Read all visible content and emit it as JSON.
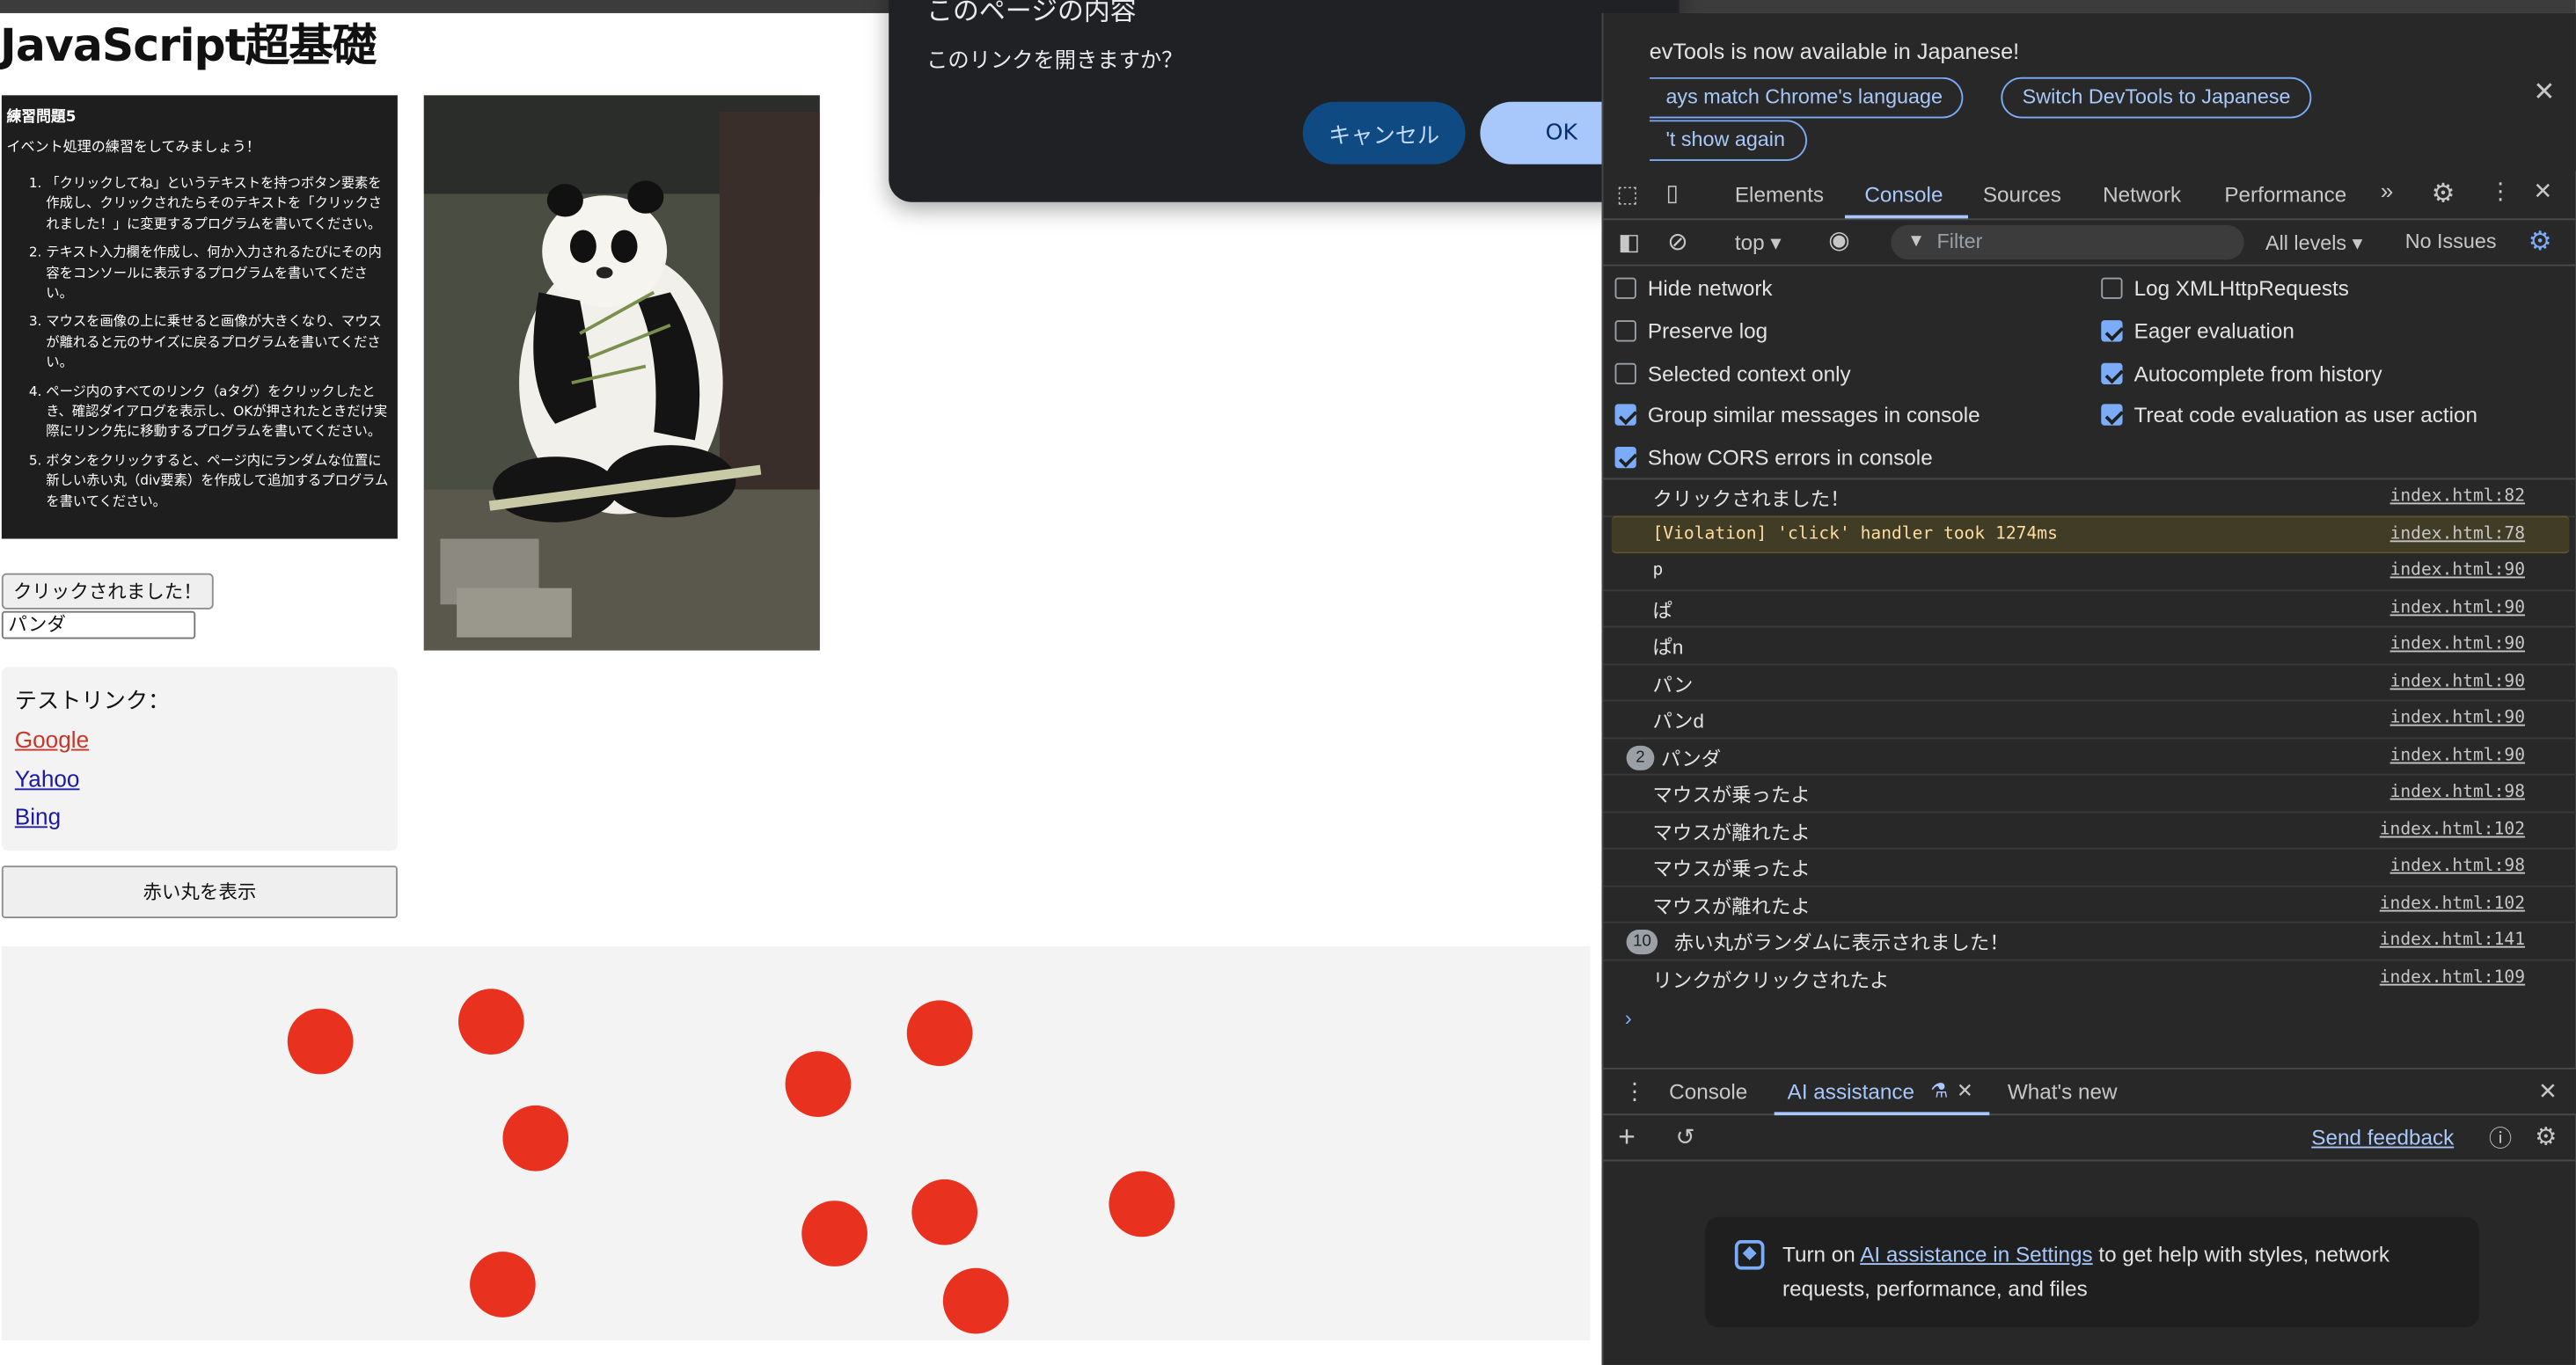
{
  "page": {
    "title": "JavaScript超基礎",
    "exercise": {
      "heading": "練習問題5",
      "intro": "イベント処理の練習をしてみましょう！",
      "items": [
        "「クリックしてね」というテキストを持つボタン要素を作成し、クリックされたらそのテキストを「クリックされました！」に変更するプログラムを書いてください。",
        "テキスト入力欄を作成し、何か入力されるたびにその内容をコンソールに表示するプログラムを書いてください。",
        "マウスを画像の上に乗せると画像が大きくなり、マウスが離れると元のサイズに戻るプログラムを書いてください。",
        "ページ内のすべてのリンク（aタグ）をクリックしたとき、確認ダイアログを表示し、OKが押されたときだけ実際にリンク先に移動するプログラムを書いてください。",
        "ボタンをクリックすると、ページ内にランダムな位置に新しい赤い丸（div要素）を作成して追加するプログラムを書いてください。"
      ]
    },
    "clicked_button_label": "クリックされました！",
    "text_input_value": "パンダ",
    "links_title": "テストリンク：",
    "links": [
      "Google",
      "Yahoo",
      "Bing"
    ],
    "red_button_label": "赤い丸を表示",
    "circle_count": 10,
    "circle_color": "#e8311f"
  },
  "dialog": {
    "title": "このページの内容",
    "message": "このリンクを開きますか？",
    "cancel_label": "キャンセル",
    "ok_label": "OK"
  },
  "devtools": {
    "banner": {
      "text": "evTools is now available in Japanese!",
      "btn_match": "ays match Chrome's language",
      "btn_switch": "Switch DevTools to Japanese",
      "btn_dont_show": "'t show again"
    },
    "tabs": [
      "Elements",
      "Console",
      "Sources",
      "Network",
      "Performance"
    ],
    "active_tab": "Console",
    "toolbar": {
      "context": "top ▾",
      "filter_placeholder": "Filter",
      "levels": "All levels ▾",
      "issues": "No Issues"
    },
    "settings": {
      "hide_network": "Hide network",
      "preserve_log": "Preserve log",
      "selected_context": "Selected context only",
      "group_similar": "Group similar messages in console",
      "show_cors": "Show CORS errors in console",
      "log_xhr": "Log XMLHttpRequests",
      "eager_eval": "Eager evaluation",
      "autocomplete": "Autocomplete from history",
      "treat_eval": "Treat code evaluation as user action"
    },
    "logs": [
      {
        "msg": "クリックされました！",
        "src": "index.html:82"
      },
      {
        "msg": "[Violation] 'click' handler took 1274ms",
        "src": "index.html:78"
      },
      {
        "msg": "p",
        "src": "index.html:90"
      },
      {
        "msg": "ぱ",
        "src": "index.html:90"
      },
      {
        "msg": "ぱn",
        "src": "index.html:90"
      },
      {
        "msg": "パン",
        "src": "index.html:90"
      },
      {
        "msg": "パンd",
        "src": "index.html:90"
      },
      {
        "msg": "パンダ",
        "src": "index.html:90",
        "badge": "2"
      },
      {
        "msg": "マウスが乗ったよ",
        "src": "index.html:98"
      },
      {
        "msg": "マウスが離れたよ",
        "src": "index.html:102"
      },
      {
        "msg": "マウスが乗ったよ",
        "src": "index.html:98"
      },
      {
        "msg": "マウスが離れたよ",
        "src": "index.html:102"
      },
      {
        "msg": "赤い丸がランダムに表示されました！",
        "src": "index.html:141",
        "badge": "10"
      },
      {
        "msg": "リンクがクリックされたよ",
        "src": "index.html:109"
      }
    ],
    "prompt": "›",
    "drawer_tabs": [
      "Console",
      "AI assistance",
      "What's new"
    ],
    "active_drawer_tab": "AI assistance",
    "send_feedback": "Send feedback",
    "ai_card": {
      "pre": "Turn on ",
      "link": "AI assistance in Settings",
      "post": " to get help with styles, network requests, performance, and files"
    }
  }
}
